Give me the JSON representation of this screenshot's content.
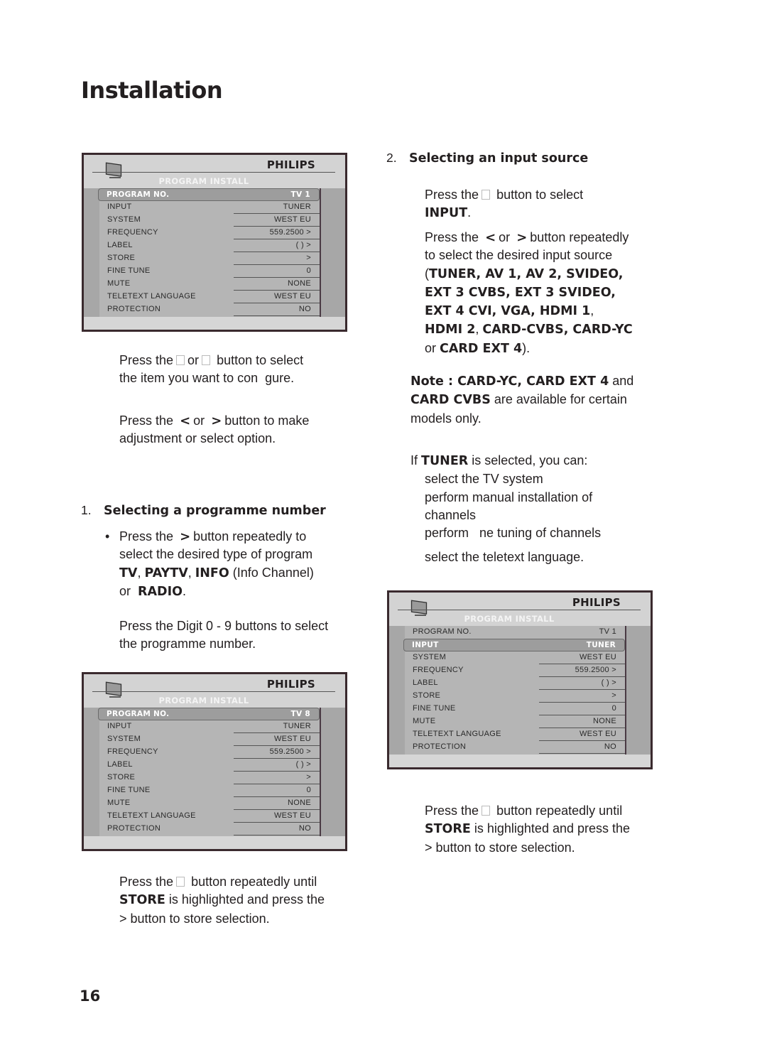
{
  "page": {
    "title": "Installation",
    "number": "16"
  },
  "menus": {
    "menu1": {
      "brand": "PHILIPS",
      "title": "PROGRAM INSTALL",
      "selected_index": 0,
      "rows": [
        {
          "label": "PROGRAM NO.",
          "value": "TV 1"
        },
        {
          "label": "INPUT",
          "value": "TUNER"
        },
        {
          "label": "SYSTEM",
          "value": "WEST EU"
        },
        {
          "label": "FREQUENCY",
          "value": "559.2500 >"
        },
        {
          "label": "LABEL",
          "value": "(          ) >"
        },
        {
          "label": "STORE",
          "value": ">"
        },
        {
          "label": "FINE TUNE",
          "value": "0"
        },
        {
          "label": "MUTE",
          "value": "NONE"
        },
        {
          "label": "TELETEXT LANGUAGE",
          "value": "WEST EU"
        },
        {
          "label": "PROTECTION",
          "value": "NO"
        }
      ]
    },
    "menu2": {
      "brand": "PHILIPS",
      "title": "PROGRAM INSTALL",
      "selected_index": 0,
      "rows": [
        {
          "label": "PROGRAM NO.",
          "value": "TV 8"
        },
        {
          "label": "INPUT",
          "value": "TUNER"
        },
        {
          "label": "SYSTEM",
          "value": "WEST EU"
        },
        {
          "label": "FREQUENCY",
          "value": "559.2500 >"
        },
        {
          "label": "LABEL",
          "value": "(          ) >"
        },
        {
          "label": "STORE",
          "value": ">"
        },
        {
          "label": "FINE TUNE",
          "value": "0"
        },
        {
          "label": "MUTE",
          "value": "NONE"
        },
        {
          "label": "TELETEXT LANGUAGE",
          "value": "WEST EU"
        },
        {
          "label": "PROTECTION",
          "value": "NO"
        }
      ]
    },
    "menu3": {
      "brand": "PHILIPS",
      "title": "PROGRAM INSTALL",
      "selected_index": 1,
      "rows": [
        {
          "label": "PROGRAM NO.",
          "value": "TV 1"
        },
        {
          "label": "INPUT",
          "value": "TUNER"
        },
        {
          "label": "SYSTEM",
          "value": "WEST EU"
        },
        {
          "label": "FREQUENCY",
          "value": "559.2500 >"
        },
        {
          "label": "LABEL",
          "value": "(          ) >"
        },
        {
          "label": "STORE",
          "value": ">"
        },
        {
          "label": "FINE TUNE",
          "value": "0"
        },
        {
          "label": "MUTE",
          "value": "NONE"
        },
        {
          "label": "TELETEXT LANGUAGE",
          "value": "WEST EU"
        },
        {
          "label": "PROTECTION",
          "value": "NO"
        }
      ]
    }
  },
  "left": {
    "p1": {
      "a": "Press the",
      "or": "or",
      "b": "button to select",
      "line2": "the item you want to con  gure."
    },
    "p2": {
      "a": "Press the",
      "lt": "<",
      "or": "or",
      "gt": ">",
      "b": "button to make",
      "line2": "adjustment or select option."
    },
    "section1": {
      "number": "1.",
      "heading": "Selecting a programme number",
      "bullet": {
        "a": "Press the",
        "gt": ">",
        "b": "button repeatedly to",
        "line2": "select the desired type of program",
        "tv": "TV",
        "paytv": "PAYTV",
        "info": "INFO",
        "info_note": "(Info Channel)",
        "or": "or",
        "radio": "RADIO"
      },
      "digits": {
        "line1": "Press the Digit 0 - 9 buttons to select",
        "line2": "the programme number."
      }
    },
    "store": {
      "a": "Press the",
      "b": "button repeatedly until",
      "store": "STORE",
      "c": "is highlighted and press the",
      "line3": "> button to store selection."
    }
  },
  "right": {
    "section2": {
      "number": "2.",
      "heading": "Selecting an input source",
      "p1": {
        "a": "Press the",
        "b": "button to select",
        "input": "INPUT"
      },
      "p2": {
        "a": "Press the",
        "lt": "<",
        "or": "or",
        "gt": ">",
        "b": "button repeatedly",
        "line2": "to select the desired input source",
        "line3": "TUNER, AV 1, AV 2, SVIDEO,",
        "line4": "EXT 3 CVBS, EXT 3 SVIDEO,",
        "line5": "EXT 4 CVI, VGA, HDMI 1",
        "line6a": "HDMI 2",
        "line6b": "CARD-CVBS, CARD-YC",
        "line7or": "or",
        "line7b": "CARD EXT 4"
      }
    },
    "note": {
      "label": "Note : CARD-YC, CARD EXT 4",
      "and": "and",
      "b": "CARD CVBS",
      "c": "are available for certain",
      "line3": "models only."
    },
    "tuner": {
      "if": "If",
      "tuner": "TUNER",
      "rest": "is selected, you can:",
      "items": [
        "select the TV system",
        "perform manual installation of",
        "channels",
        "perform   ne tuning of channels",
        "select the teletext language."
      ]
    },
    "store": {
      "a": "Press the",
      "b": "button repeatedly until",
      "store": "STORE",
      "c": "is highlighted and press the",
      "line3": "> button to store selection."
    }
  }
}
